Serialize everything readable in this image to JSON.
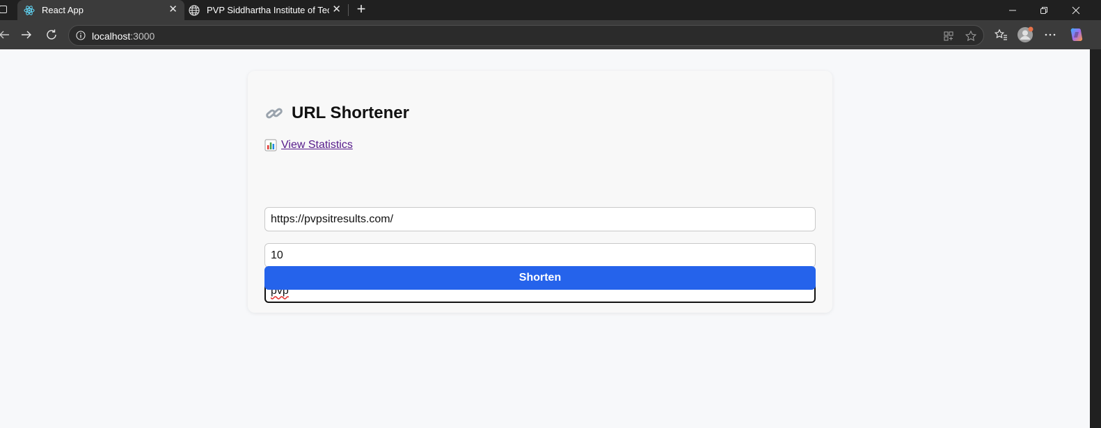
{
  "browser": {
    "tabs": [
      {
        "title": "React App",
        "active": true
      },
      {
        "title": "PVP Siddhartha Institute of Techn",
        "active": false
      }
    ],
    "address": {
      "host": "localhost",
      "port": ":3000"
    }
  },
  "app": {
    "title": "URL Shortener",
    "stats_link": "View Statistics",
    "inputs": {
      "url_value": "https://pvpsitresults.com/",
      "validity_value": "10",
      "shortcode_value": "pvp"
    },
    "submit_label": "Shorten"
  },
  "colors": {
    "accent": "#2563eb",
    "link_visited": "#551a8b"
  }
}
